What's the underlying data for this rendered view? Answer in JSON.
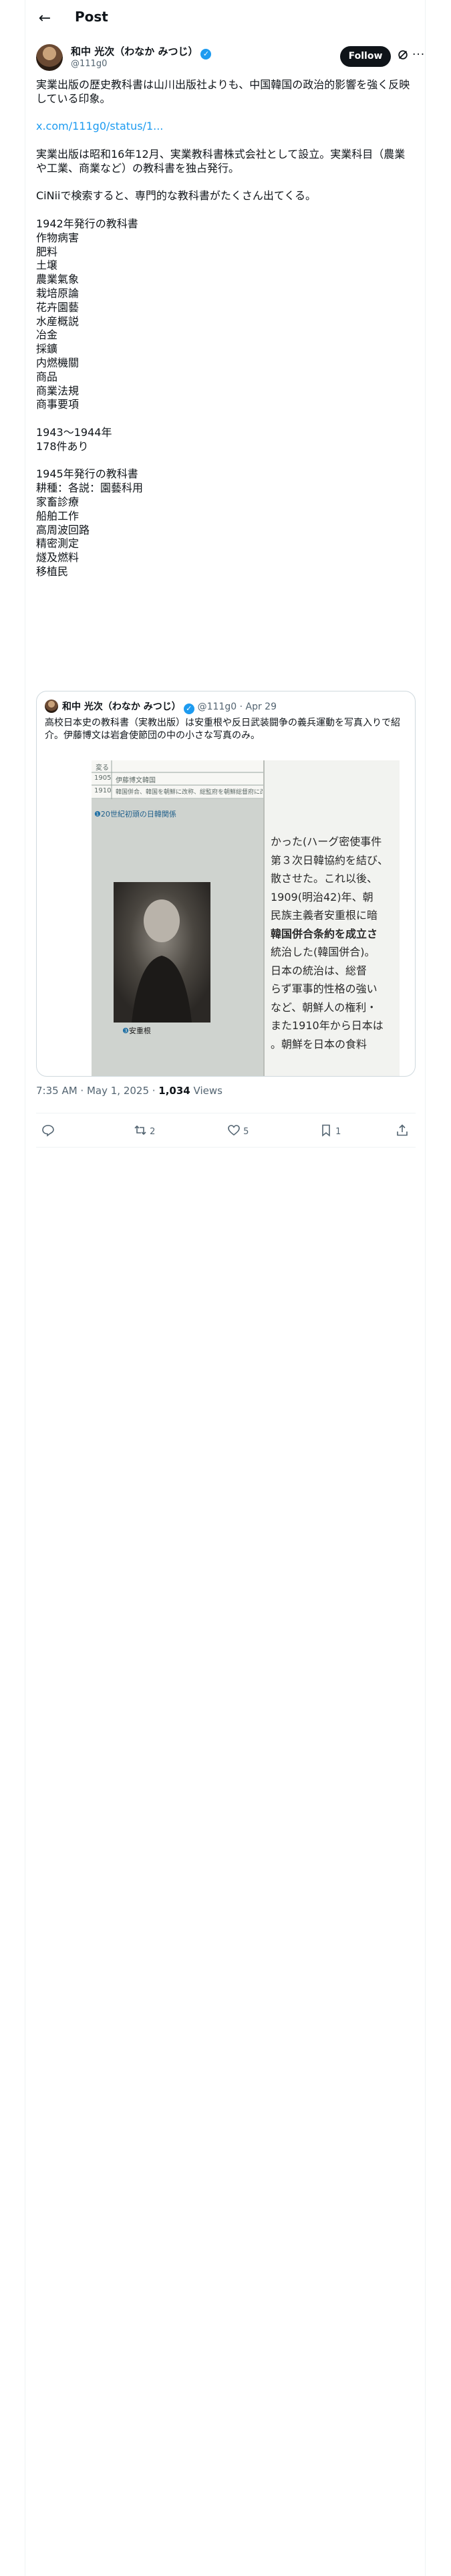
{
  "header": {
    "back_icon": "arrow-left-icon",
    "title": "Post"
  },
  "author": {
    "display_name": "和中 光次（わなか みつじ）",
    "handle": "@111g0",
    "follow_label": "Follow",
    "grok_icon": "grok-icon",
    "more_icon": "more-icon"
  },
  "post": {
    "p1": "実業出版の歴史教科書は山川出版社よりも、中国韓国の政治的影響を強く反映している印象。",
    "link": "x.com/111g0/status/1...",
    "p2": "実業出版は昭和16年12月、実業教科書株式会社として設立。実業科目（農業や工業、商業など）の教科書を独占発行。",
    "p3": "CiNiiで検索すると、専門的な教科書がたくさん出てくる。",
    "p4": "1942年発行の教科書\n作物病害\n肥料\n土壌\n農業氣象\n栽培原論\n花卉園藝\n水産概説\n冶金\n採鑛\n内燃機關\n商品\n商業法規\n商事要項",
    "p5": "1943〜1944年\n178件あり",
    "p6": "1945年発行の教科書\n耕種：各説：園藝科用\n家畜診療\n船舶工作\n高周波回路\n精密測定\n燧及燃料\n移植民"
  },
  "quote": {
    "display_name": "和中 光次（わなか みつじ）",
    "handle": "@111g0",
    "date": "Apr 29",
    "text": "高校日本史の教科書（実教出版）は安重根や反日武装闘争の義兵運動を写真入りで紹介。伊藤博文は岩倉使節団の中の小さな写真のみ。",
    "image": {
      "table_rows": [
        {
          "year": "",
          "text": "変る"
        },
        {
          "year": "1905",
          "text": "伊藤博文韓国"
        },
        {
          "year": "1910",
          "text": "韓国併合、韓国を朝鮮に改称、総監府を朝鮮総督府に改編"
        }
      ],
      "map_caption": "20世紀初頭の日韓関係",
      "photo_caption": "安重根",
      "text_lines": [
        "かった(ハーグ密使事件",
        "第３次日韓協約を結び、",
        "散させた。これ以後、",
        "1909(明治42)年、朝",
        "民族主義者安重根に暗",
        "韓国併合条約を成立さ",
        "統治した(韓国併合)。",
        "日本の統治は、総督",
        "らず軍事的性格の強い",
        "など、朝鮮人の権利・",
        "また1910年から日本は",
        "。朝鮮を日本の食料"
      ]
    }
  },
  "meta": {
    "time": "7:35 AM · May 1, 2025 · ",
    "views_count": "1,034",
    "views_label": " Views"
  },
  "actions": {
    "reply_icon": "reply-icon",
    "repost_count": "2",
    "like_count": "5",
    "bookmark_count": "1",
    "share_icon": "share-icon"
  }
}
